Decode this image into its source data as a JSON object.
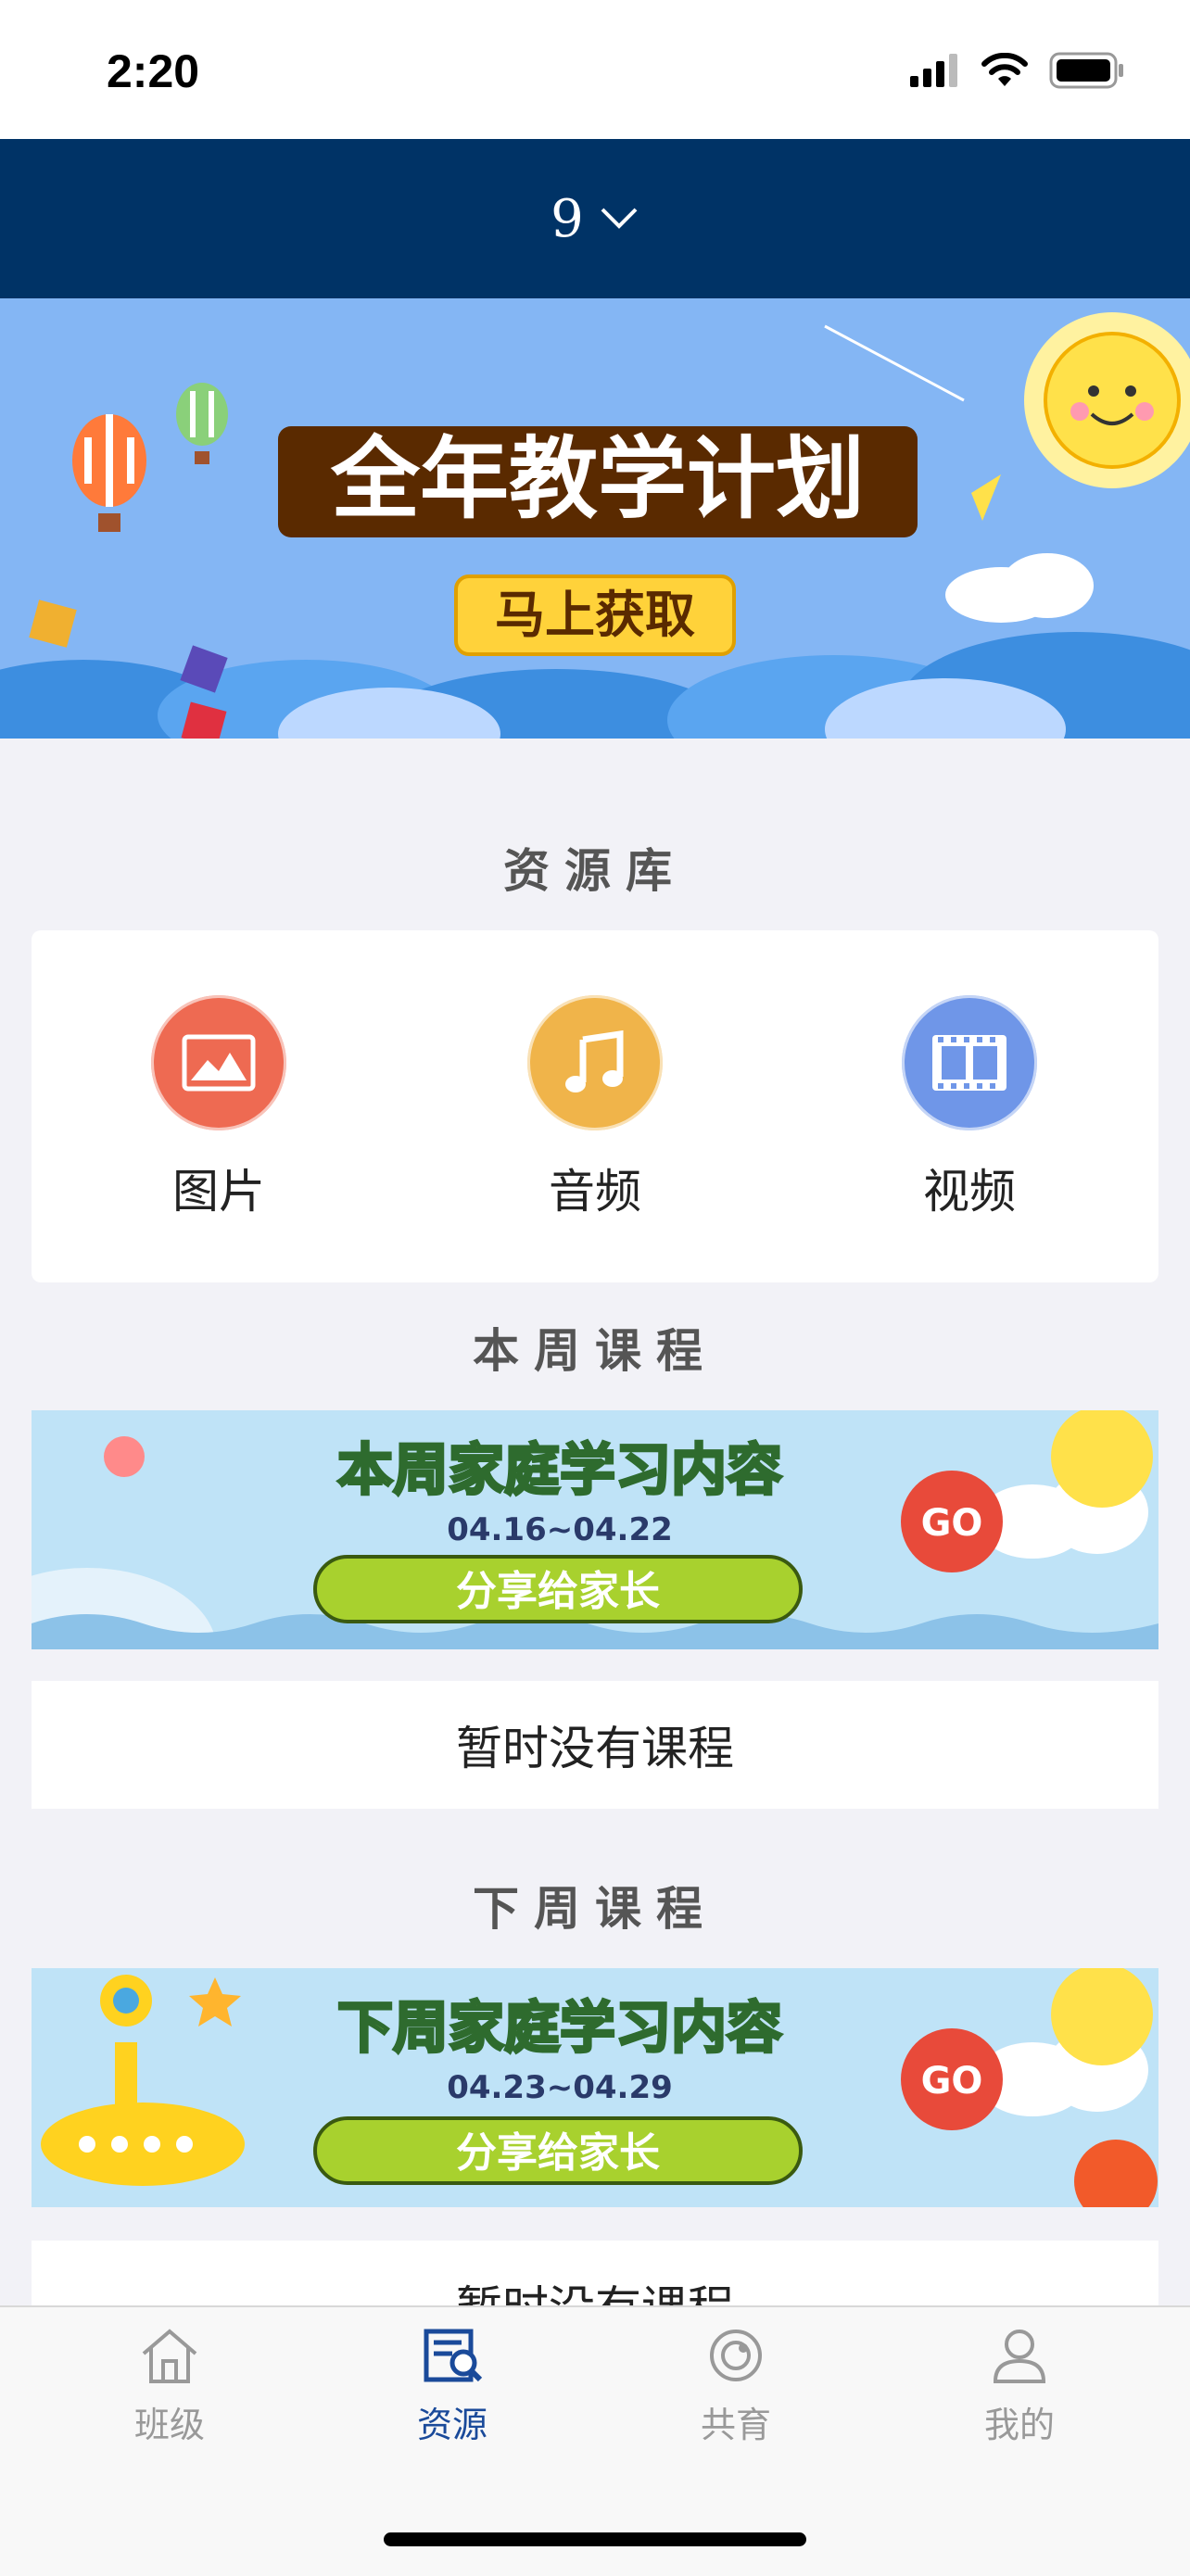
{
  "status_bar": {
    "time": "2:20"
  },
  "header": {
    "week_value": "9"
  },
  "hero_banner": {
    "title": "全年教学计划",
    "button": "马上获取"
  },
  "resource_library": {
    "title": "资源库",
    "items": [
      {
        "label": "图片",
        "icon": "image-icon",
        "color": "#ee6a52"
      },
      {
        "label": "音频",
        "icon": "music-note-icon",
        "color": "#f0b44a"
      },
      {
        "label": "视频",
        "icon": "film-icon",
        "color": "#6f96e8"
      }
    ]
  },
  "this_week": {
    "title": "本周课程",
    "banner_title": "本周家庭学习内容",
    "date_range": "04.16~04.22",
    "share_label": "分享给家长",
    "go_label": "GO",
    "empty_text": "暂时没有课程"
  },
  "next_week": {
    "title": "下周课程",
    "banner_title": "下周家庭学习内容",
    "date_range": "04.23~04.29",
    "share_label": "分享给家长",
    "go_label": "GO",
    "empty_text": "暂时没有课程"
  },
  "tabs": [
    {
      "label": "班级",
      "icon": "home-icon",
      "active": false
    },
    {
      "label": "资源",
      "icon": "resource-search-icon",
      "active": true
    },
    {
      "label": "共育",
      "icon": "coeducation-icon",
      "active": false
    },
    {
      "label": "我的",
      "icon": "profile-icon",
      "active": false
    }
  ],
  "colors": {
    "header": "#003366",
    "active_tab": "#1a4a9a",
    "inactive_tab": "#999999",
    "banner_sky": "#8ab8f5"
  }
}
